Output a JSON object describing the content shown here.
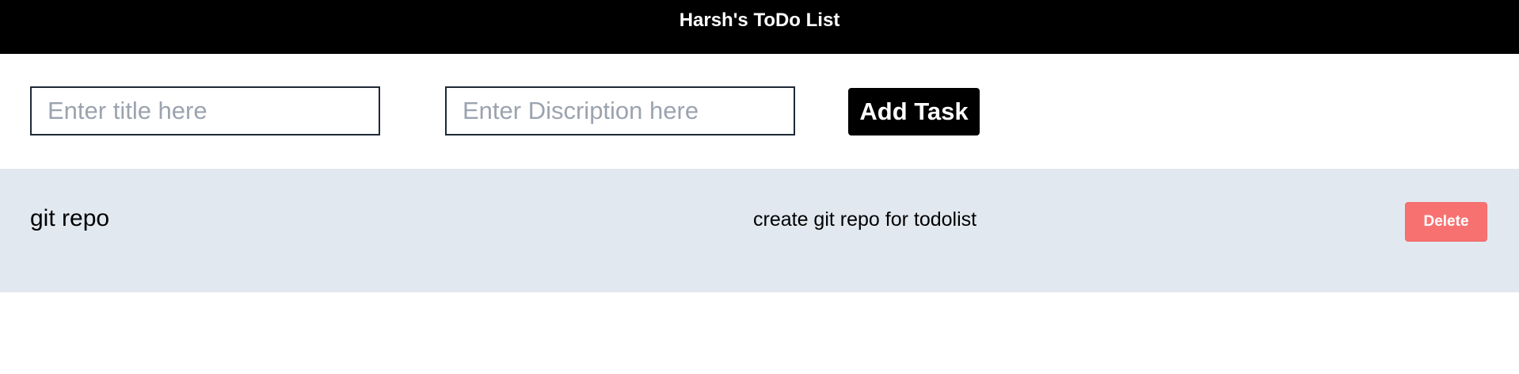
{
  "header": {
    "title": "Harsh's ToDo List"
  },
  "form": {
    "title_placeholder": "Enter title here",
    "title_value": "",
    "description_placeholder": "Enter Discription here",
    "description_value": "",
    "add_button_label": "Add Task"
  },
  "tasks": [
    {
      "title": "git repo",
      "description": "create git repo for todolist",
      "delete_label": "Delete"
    }
  ],
  "colors": {
    "header_bg": "#000000",
    "task_row_bg": "#e2e8f0",
    "delete_button_bg": "#f87171"
  }
}
